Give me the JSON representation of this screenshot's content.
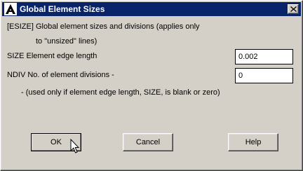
{
  "window": {
    "title": "Global Element Sizes",
    "icon": "ansys-logo-icon",
    "close_symbol": "close-icon"
  },
  "header": {
    "line1": "[ESIZE]  Global element sizes and divisions (applies only",
    "line2": "to \"unsized\" lines)"
  },
  "size_field": {
    "label": "SIZE  Element edge length",
    "value": "0.002"
  },
  "ndiv_field": {
    "label": "NDIV  No. of element divisions -",
    "value": "0"
  },
  "note": "- (used only if element edge length, SIZE, is blank or zero)",
  "buttons": {
    "ok": "OK",
    "cancel": "Cancel",
    "help": "Help"
  },
  "colors": {
    "titlebar": "#0a246a",
    "face": "#d4d0c8"
  }
}
